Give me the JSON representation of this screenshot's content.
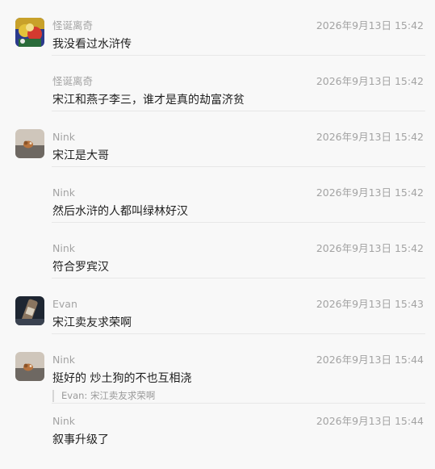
{
  "messages": [
    {
      "name": "怪诞离奇",
      "time": "2026年9月13日 15:42",
      "text": "我没看过水浒传",
      "avatar": "avatar-colorful"
    },
    {
      "name": "怪诞离奇",
      "time": "2026年9月13日 15:42",
      "text": "宋江和燕子李三，谁才是真的劫富济贫"
    },
    {
      "name": "Nink",
      "time": "2026年9月13日 15:42",
      "text": "宋江是大哥",
      "avatar": "avatar-cat"
    },
    {
      "name": "Nink",
      "time": "2026年9月13日 15:42",
      "text": "然后水浒的人都叫绿林好汉"
    },
    {
      "name": "Nink",
      "time": "2026年9月13日 15:42",
      "text": "符合罗宾汉"
    },
    {
      "name": "Evan",
      "time": "2026年9月13日 15:43",
      "text": "宋江卖友求荣啊",
      "avatar": "avatar-bottle"
    },
    {
      "name": "Nink",
      "time": "2026年9月13日 15:44",
      "text": "挺好的 炒土狗的不也互相浇",
      "quote": "Evan: 宋江卖友求荣啊",
      "avatar": "avatar-cat"
    },
    {
      "name": "Nink",
      "time": "2026年9月13日 15:44",
      "text": "叙事升级了"
    }
  ]
}
